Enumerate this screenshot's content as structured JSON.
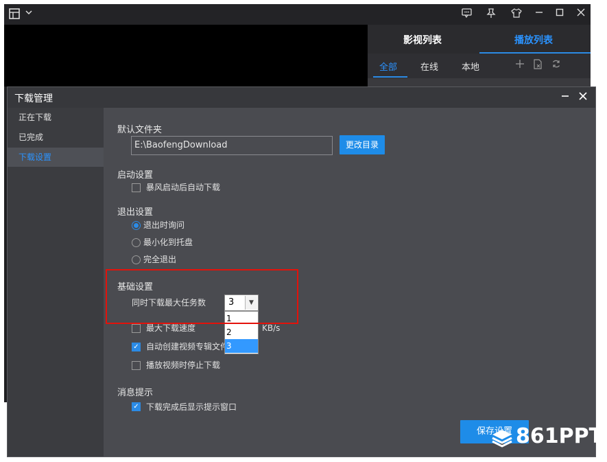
{
  "player": {
    "side_tabs": [
      "影视列表",
      "播放列表"
    ],
    "sub_tabs": [
      "全部",
      "在线",
      "本地"
    ],
    "titlebar_icons": [
      "layout-icon",
      "chevron-down-icon",
      "message-icon",
      "pin-icon",
      "skin-icon",
      "minimize-icon",
      "maximize-icon",
      "close-icon"
    ],
    "side_tools": [
      "add-icon",
      "delete-file-icon",
      "refresh-icon"
    ]
  },
  "dialog": {
    "title": "下载管理",
    "nav": [
      "正在下载",
      "已完成",
      "下载设置"
    ],
    "active_nav": 2,
    "default_folder": {
      "title": "默认文件夹",
      "path": "E:\\BaofengDownload",
      "change_button": "更改目录"
    },
    "startup": {
      "title": "启动设置",
      "options": [
        {
          "label": "暴风启动后自动下载",
          "checked": false
        }
      ]
    },
    "exit": {
      "title": "退出设置",
      "options": [
        {
          "label": "退出时询问",
          "selected": true
        },
        {
          "label": "最小化到托盘",
          "selected": false
        },
        {
          "label": "完全退出",
          "selected": false
        }
      ]
    },
    "basic": {
      "title": "基础设置",
      "max_tasks_label": "同时下载最大任务数",
      "max_tasks_value": "3",
      "dropdown_options": [
        "1",
        "2",
        "3"
      ],
      "dropdown_highlight": 2,
      "max_speed_label": "最大下载速度",
      "speed_unit": "KB/s",
      "auto_album_label": "自动创建视频专辑文件",
      "stop_on_play_label": "播放视频时停止下载"
    },
    "notify": {
      "title": "消息提示",
      "option": "下载完成后显示提示窗口"
    },
    "save_button": "保存设置"
  },
  "watermark": "861PPT",
  "colors": {
    "accent": "#2b8be6",
    "annotation": "#e3120b"
  }
}
